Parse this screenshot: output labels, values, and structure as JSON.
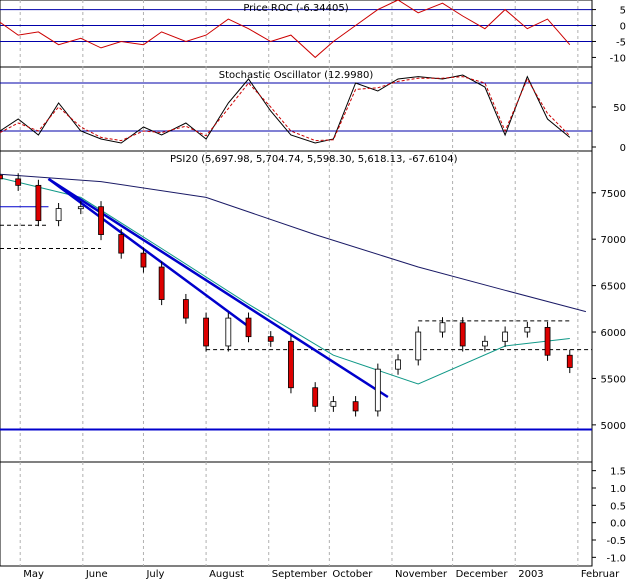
{
  "chart_data": [
    {
      "type": "line",
      "title": "Price ROC (-6.34405)",
      "ylim": [
        -13,
        8
      ],
      "y_ticks": [
        5,
        0,
        -5,
        -10
      ],
      "reference_lines": [
        5,
        0,
        -5
      ],
      "series": [
        {
          "color": "#cc0000",
          "x": [
            "2002-04-21",
            "2002-04-30",
            "2002-05-10",
            "2002-05-20",
            "2002-05-31",
            "2002-06-10",
            "2002-06-20",
            "2002-07-01",
            "2002-07-10",
            "2002-07-22",
            "2002-08-01",
            "2002-08-12",
            "2002-08-22",
            "2002-09-02",
            "2002-09-12",
            "2002-09-24",
            "2002-10-03",
            "2002-10-14",
            "2002-10-25",
            "2002-11-04",
            "2002-11-14",
            "2002-11-26",
            "2002-12-06",
            "2002-12-17",
            "2002-12-27",
            "2003-01-07",
            "2003-01-17",
            "2003-01-28"
          ],
          "values": [
            1,
            -3,
            -2,
            -6,
            -4,
            -7,
            -5,
            -6,
            -2,
            -5,
            -3,
            2,
            -1,
            -5,
            -3,
            -10,
            -5,
            0,
            5,
            8,
            4,
            7,
            3,
            -1,
            5,
            -1,
            2,
            -6
          ]
        }
      ]
    },
    {
      "type": "line",
      "title": "Stochastic Oscillator (12.9980)",
      "ylim": [
        -5,
        100
      ],
      "y_ticks": [
        50,
        0
      ],
      "reference_lines": [
        80,
        20
      ],
      "series": [
        {
          "color": "#000000",
          "x": [
            "2002-04-21",
            "2002-04-30",
            "2002-05-10",
            "2002-05-20",
            "2002-05-31",
            "2002-06-10",
            "2002-06-20",
            "2002-07-01",
            "2002-07-10",
            "2002-07-22",
            "2002-08-01",
            "2002-08-12",
            "2002-08-22",
            "2002-09-02",
            "2002-09-12",
            "2002-09-24",
            "2002-10-03",
            "2002-10-14",
            "2002-10-25",
            "2002-11-04",
            "2002-11-14",
            "2002-11-26",
            "2002-12-06",
            "2002-12-17",
            "2002-12-27",
            "2003-01-07",
            "2003-01-17",
            "2003-01-28"
          ],
          "values": [
            20,
            35,
            15,
            55,
            20,
            10,
            5,
            25,
            15,
            30,
            10,
            55,
            85,
            45,
            15,
            5,
            10,
            80,
            70,
            85,
            88,
            85,
            90,
            75,
            15,
            88,
            35,
            12
          ]
        },
        {
          "color": "#cc0000",
          "dashed": true,
          "x": [
            "2002-04-21",
            "2002-04-30",
            "2002-05-10",
            "2002-05-20",
            "2002-05-31",
            "2002-06-10",
            "2002-06-20",
            "2002-07-01",
            "2002-07-10",
            "2002-07-22",
            "2002-08-01",
            "2002-08-12",
            "2002-08-22",
            "2002-09-02",
            "2002-09-12",
            "2002-09-24",
            "2002-10-03",
            "2002-10-14",
            "2002-10-25",
            "2002-11-04",
            "2002-11-14",
            "2002-11-26",
            "2002-12-06",
            "2002-12-17",
            "2002-12-27",
            "2003-01-07",
            "2003-01-17",
            "2003-01-28"
          ],
          "values": [
            18,
            30,
            20,
            50,
            25,
            12,
            8,
            20,
            18,
            26,
            14,
            48,
            80,
            50,
            20,
            8,
            9,
            72,
            74,
            82,
            86,
            86,
            88,
            80,
            20,
            85,
            42,
            14
          ]
        }
      ]
    },
    {
      "type": "candlestick",
      "title": "PSI20 (5,697.98, 5,704.74, 5,598.30, 5,618.13, -67.6104)",
      "ylim": [
        4600,
        7950
      ],
      "y_ticks": [
        7500,
        7000,
        6500,
        6000,
        5500,
        5000
      ],
      "x_axis_labels": [
        "May",
        "June",
        "July",
        "August",
        "September",
        "October",
        "November",
        "December",
        "2003",
        "Februar"
      ],
      "x_label_dates": [
        "2002-05-01",
        "2002-06-01",
        "2002-07-01",
        "2002-08-01",
        "2002-09-01",
        "2002-10-01",
        "2002-11-01",
        "2002-12-01",
        "2003-01-01",
        "2003-02-01"
      ],
      "x_range": [
        "2002-04-21",
        "2003-02-08"
      ],
      "close_series": {
        "x": [
          "2002-04-21",
          "2002-04-30",
          "2002-05-10",
          "2002-05-20",
          "2002-05-31",
          "2002-06-10",
          "2002-06-20",
          "2002-07-01",
          "2002-07-10",
          "2002-07-22",
          "2002-08-01",
          "2002-08-12",
          "2002-08-22",
          "2002-09-02",
          "2002-09-12",
          "2002-09-24",
          "2002-10-03",
          "2002-10-14",
          "2002-10-25",
          "2002-11-04",
          "2002-11-14",
          "2002-11-26",
          "2002-12-06",
          "2002-12-17",
          "2002-12-27",
          "2003-01-07",
          "2003-01-17",
          "2003-01-28"
        ],
        "values": [
          7650,
          7580,
          7200,
          7330,
          7350,
          7050,
          6850,
          6700,
          6350,
          6150,
          5850,
          6150,
          5950,
          5900,
          5400,
          5200,
          5250,
          5150,
          5600,
          5700,
          6000,
          6100,
          5850,
          5900,
          6000,
          6050,
          5750,
          5618
        ]
      },
      "moving_averages": [
        {
          "color": "#1a1a66",
          "x": [
            "2002-04-21",
            "2002-06-10",
            "2002-08-01",
            "2002-09-24",
            "2002-11-14",
            "2002-12-27",
            "2003-02-05"
          ],
          "values": [
            7700,
            7620,
            7450,
            7050,
            6700,
            6450,
            6220
          ]
        },
        {
          "color": "#119988",
          "x": [
            "2002-04-21",
            "2002-05-31",
            "2002-07-10",
            "2002-08-22",
            "2002-10-03",
            "2002-11-14",
            "2002-12-27",
            "2003-01-28"
          ],
          "values": [
            7660,
            7450,
            6900,
            6300,
            5750,
            5440,
            5850,
            5930
          ]
        }
      ],
      "trendlines": [
        {
          "color": "#0000cc",
          "x": [
            "2002-05-15",
            "2002-10-30"
          ],
          "values": [
            7650,
            5300
          ]
        },
        {
          "color": "#0000cc",
          "x": [
            "2002-05-15",
            "2002-08-22"
          ],
          "values": [
            7650,
            6060
          ]
        }
      ],
      "horizontal_lines": [
        {
          "style": "solid",
          "y": 7350,
          "x": [
            "2002-04-21",
            "2002-05-15"
          ]
        },
        {
          "style": "dashed",
          "y": 7150,
          "x": [
            "2002-04-21",
            "2002-05-15"
          ]
        },
        {
          "style": "dashed",
          "y": 6900,
          "x": [
            "2002-04-21",
            "2002-06-10"
          ]
        },
        {
          "style": "dashed",
          "y": 5810,
          "x": [
            "2002-08-01",
            "2003-02-08"
          ]
        },
        {
          "style": "dashed",
          "y": 6120,
          "x": [
            "2002-11-14",
            "2003-01-28"
          ]
        },
        {
          "style": "solid-thick",
          "y": 4950,
          "x": [
            "2002-04-21",
            "2003-02-08"
          ]
        }
      ]
    },
    {
      "type": "line",
      "title": "",
      "ylim": [
        -1.25,
        1.75
      ],
      "y_ticks": [
        1.5,
        1.0,
        0.5,
        0.0,
        -0.5,
        -1.0
      ],
      "y_tick_labels": [
        "1.5",
        "1.0",
        "0.5",
        "0.0",
        "-0.5",
        "-1.0"
      ],
      "series": []
    }
  ]
}
